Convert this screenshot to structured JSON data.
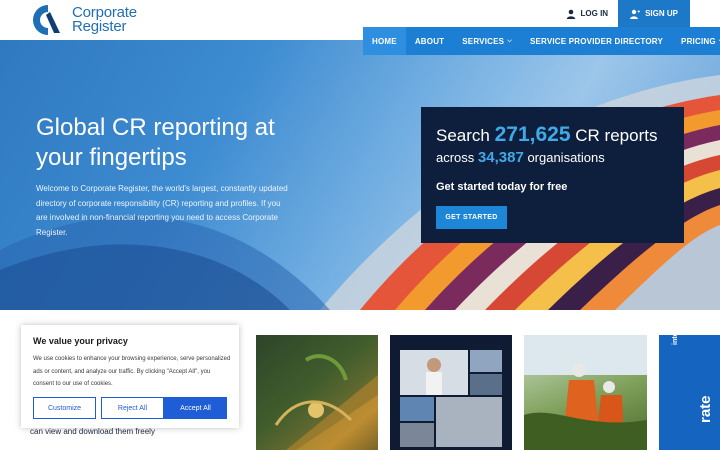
{
  "header": {
    "logo_line1": "Corporate",
    "logo_line2": "Register",
    "login_label": "LOG IN",
    "signup_label": "SIGN UP"
  },
  "nav": {
    "items": [
      {
        "label": "HOME",
        "active": true
      },
      {
        "label": "ABOUT"
      },
      {
        "label": "SERVICES",
        "dropdown": true
      },
      {
        "label": "SERVICE PROVIDER DIRECTORY"
      },
      {
        "label": "PRICING",
        "dropdown": true
      }
    ]
  },
  "hero": {
    "title": "Global CR reporting at your fingertips",
    "text": "Welcome to Corporate Register, the world's largest, constantly updated directory of corporate responsibility (CR) reporting and profiles. If you are involved in non-financial reporting you need to access Corporate Register."
  },
  "stats": {
    "search_prefix": "Search",
    "reports_count": "271,625",
    "reports_suffix": "CR reports",
    "across_prefix": "across",
    "org_count": "34,387",
    "org_suffix": "organisations",
    "cta_text": "Get started today for free",
    "button_label": "GET STARTED"
  },
  "lower": {
    "partial_text": "can view and download them freely",
    "card4_text": "rate",
    "card4_brand": "intel"
  },
  "cookie": {
    "title": "We value your privacy",
    "text": "We use cookies to enhance your browsing experience, serve personalized ads or content, and analyze our traffic. By clicking \"Accept All\", you consent to our use of cookies.",
    "customize_label": "Customize",
    "reject_label": "Reject All",
    "accept_label": "Accept All"
  },
  "colors": {
    "brand_blue": "#1e78c8",
    "nav_blue": "#1d7fd4",
    "stat_box": "#0e1f3d",
    "accent_light_blue": "#41a9e8"
  }
}
